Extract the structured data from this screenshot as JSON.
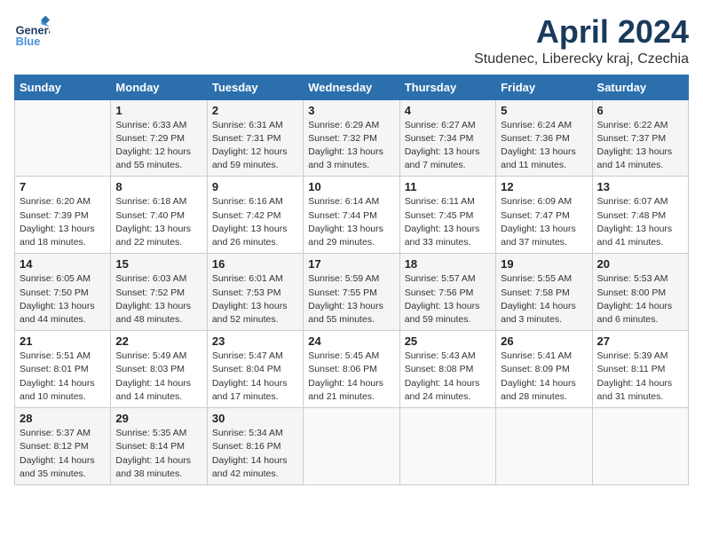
{
  "header": {
    "logo": {
      "general": "General",
      "blue": "Blue"
    },
    "title": "April 2024",
    "location": "Studenec, Liberecky kraj, Czechia"
  },
  "weekdays": [
    "Sunday",
    "Monday",
    "Tuesday",
    "Wednesday",
    "Thursday",
    "Friday",
    "Saturday"
  ],
  "weeks": [
    [
      {
        "day": "",
        "info": ""
      },
      {
        "day": "1",
        "info": "Sunrise: 6:33 AM\nSunset: 7:29 PM\nDaylight: 12 hours\nand 55 minutes."
      },
      {
        "day": "2",
        "info": "Sunrise: 6:31 AM\nSunset: 7:31 PM\nDaylight: 12 hours\nand 59 minutes."
      },
      {
        "day": "3",
        "info": "Sunrise: 6:29 AM\nSunset: 7:32 PM\nDaylight: 13 hours\nand 3 minutes."
      },
      {
        "day": "4",
        "info": "Sunrise: 6:27 AM\nSunset: 7:34 PM\nDaylight: 13 hours\nand 7 minutes."
      },
      {
        "day": "5",
        "info": "Sunrise: 6:24 AM\nSunset: 7:36 PM\nDaylight: 13 hours\nand 11 minutes."
      },
      {
        "day": "6",
        "info": "Sunrise: 6:22 AM\nSunset: 7:37 PM\nDaylight: 13 hours\nand 14 minutes."
      }
    ],
    [
      {
        "day": "7",
        "info": "Sunrise: 6:20 AM\nSunset: 7:39 PM\nDaylight: 13 hours\nand 18 minutes."
      },
      {
        "day": "8",
        "info": "Sunrise: 6:18 AM\nSunset: 7:40 PM\nDaylight: 13 hours\nand 22 minutes."
      },
      {
        "day": "9",
        "info": "Sunrise: 6:16 AM\nSunset: 7:42 PM\nDaylight: 13 hours\nand 26 minutes."
      },
      {
        "day": "10",
        "info": "Sunrise: 6:14 AM\nSunset: 7:44 PM\nDaylight: 13 hours\nand 29 minutes."
      },
      {
        "day": "11",
        "info": "Sunrise: 6:11 AM\nSunset: 7:45 PM\nDaylight: 13 hours\nand 33 minutes."
      },
      {
        "day": "12",
        "info": "Sunrise: 6:09 AM\nSunset: 7:47 PM\nDaylight: 13 hours\nand 37 minutes."
      },
      {
        "day": "13",
        "info": "Sunrise: 6:07 AM\nSunset: 7:48 PM\nDaylight: 13 hours\nand 41 minutes."
      }
    ],
    [
      {
        "day": "14",
        "info": "Sunrise: 6:05 AM\nSunset: 7:50 PM\nDaylight: 13 hours\nand 44 minutes."
      },
      {
        "day": "15",
        "info": "Sunrise: 6:03 AM\nSunset: 7:52 PM\nDaylight: 13 hours\nand 48 minutes."
      },
      {
        "day": "16",
        "info": "Sunrise: 6:01 AM\nSunset: 7:53 PM\nDaylight: 13 hours\nand 52 minutes."
      },
      {
        "day": "17",
        "info": "Sunrise: 5:59 AM\nSunset: 7:55 PM\nDaylight: 13 hours\nand 55 minutes."
      },
      {
        "day": "18",
        "info": "Sunrise: 5:57 AM\nSunset: 7:56 PM\nDaylight: 13 hours\nand 59 minutes."
      },
      {
        "day": "19",
        "info": "Sunrise: 5:55 AM\nSunset: 7:58 PM\nDaylight: 14 hours\nand 3 minutes."
      },
      {
        "day": "20",
        "info": "Sunrise: 5:53 AM\nSunset: 8:00 PM\nDaylight: 14 hours\nand 6 minutes."
      }
    ],
    [
      {
        "day": "21",
        "info": "Sunrise: 5:51 AM\nSunset: 8:01 PM\nDaylight: 14 hours\nand 10 minutes."
      },
      {
        "day": "22",
        "info": "Sunrise: 5:49 AM\nSunset: 8:03 PM\nDaylight: 14 hours\nand 14 minutes."
      },
      {
        "day": "23",
        "info": "Sunrise: 5:47 AM\nSunset: 8:04 PM\nDaylight: 14 hours\nand 17 minutes."
      },
      {
        "day": "24",
        "info": "Sunrise: 5:45 AM\nSunset: 8:06 PM\nDaylight: 14 hours\nand 21 minutes."
      },
      {
        "day": "25",
        "info": "Sunrise: 5:43 AM\nSunset: 8:08 PM\nDaylight: 14 hours\nand 24 minutes."
      },
      {
        "day": "26",
        "info": "Sunrise: 5:41 AM\nSunset: 8:09 PM\nDaylight: 14 hours\nand 28 minutes."
      },
      {
        "day": "27",
        "info": "Sunrise: 5:39 AM\nSunset: 8:11 PM\nDaylight: 14 hours\nand 31 minutes."
      }
    ],
    [
      {
        "day": "28",
        "info": "Sunrise: 5:37 AM\nSunset: 8:12 PM\nDaylight: 14 hours\nand 35 minutes."
      },
      {
        "day": "29",
        "info": "Sunrise: 5:35 AM\nSunset: 8:14 PM\nDaylight: 14 hours\nand 38 minutes."
      },
      {
        "day": "30",
        "info": "Sunrise: 5:34 AM\nSunset: 8:16 PM\nDaylight: 14 hours\nand 42 minutes."
      },
      {
        "day": "",
        "info": ""
      },
      {
        "day": "",
        "info": ""
      },
      {
        "day": "",
        "info": ""
      },
      {
        "day": "",
        "info": ""
      }
    ]
  ]
}
